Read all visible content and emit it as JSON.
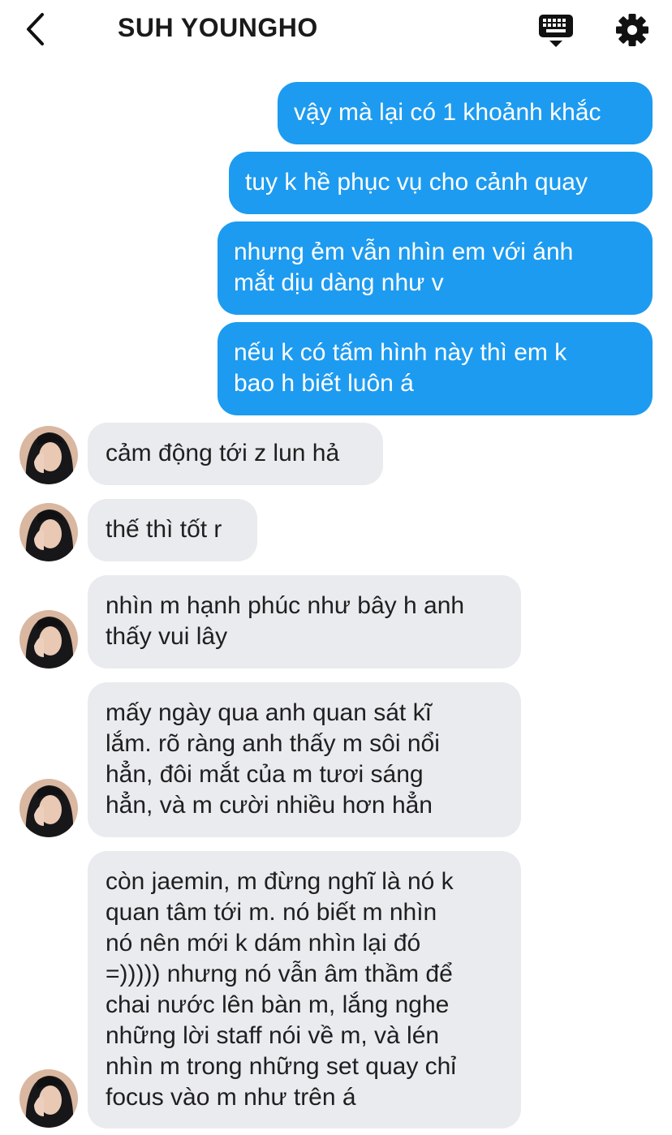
{
  "header": {
    "title": "SUH YOUNGHO",
    "back_icon": "chevron-left-icon",
    "keyboard_icon": "keyboard-icon",
    "settings_icon": "gear-icon"
  },
  "colors": {
    "outgoing_bubble": "#1d9bf0",
    "incoming_bubble": "#e9ebee"
  },
  "outgoing_messages": [
    {
      "lines": [
        "vậy mà lại có 1 khoảnh khắc"
      ]
    },
    {
      "lines": [
        "tuy k hề phục vụ cho cảnh quay"
      ]
    },
    {
      "lines": [
        "nhưng ẻm vẫn nhìn em với ánh",
        "mắt dịu dàng như v"
      ]
    },
    {
      "lines": [
        "nếu k có tấm hình này thì em k",
        "bao h biết luôn á"
      ]
    }
  ],
  "incoming_messages": [
    {
      "lines": [
        "cảm động tới z lun hả"
      ]
    },
    {
      "lines": [
        "thế thì tốt r"
      ]
    },
    {
      "lines": [
        "nhìn m hạnh phúc như bây h anh",
        "thấy vui lây"
      ]
    },
    {
      "lines": [
        "mấy ngày qua anh quan sát kĩ",
        "lắm. rõ ràng anh thấy m sôi nổi",
        "hẳn, đôi mắt của m tươi sáng",
        "hẳn, và m cười nhiều hơn hẳn"
      ]
    },
    {
      "lines": [
        "còn jaemin, m đừng nghĩ là nó k",
        "quan tâm tới m. nó biết m nhìn",
        "nó nên mới k dám nhìn lại đó",
        "=))))) nhưng nó vẫn âm thầm để",
        "chai nước lên bàn m, lắng nghe",
        "những lời staff nói về m, và lén",
        "nhìn m trong những set quay chỉ",
        "focus vào m như trên á"
      ]
    }
  ]
}
